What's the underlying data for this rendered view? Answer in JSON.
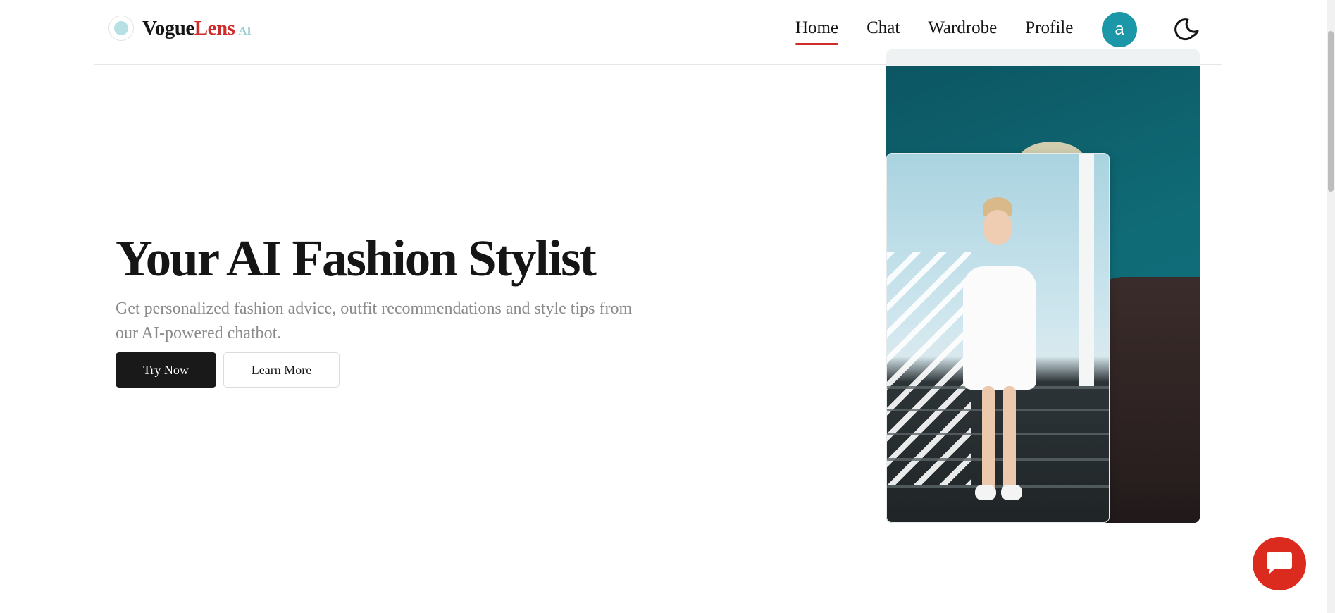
{
  "brand": {
    "name_part1": "Vogue",
    "name_part2": "Lens",
    "suffix": "AI"
  },
  "nav": {
    "items": [
      {
        "label": "Home",
        "active": true
      },
      {
        "label": "Chat",
        "active": false
      },
      {
        "label": "Wardrobe",
        "active": false
      },
      {
        "label": "Profile",
        "active": false
      }
    ],
    "avatar_initial": "a",
    "theme_toggle_icon": "moon-icon"
  },
  "hero": {
    "title": "Your AI Fashion Stylist",
    "subtitle": "Get personalized fashion advice, outfit recommendations and style tips from our AI-powered chatbot.",
    "primary_button": "Try Now",
    "secondary_button": "Learn More"
  },
  "images": {
    "back_photo": "model-in-dark-coat-on-teal-background",
    "front_photo": "woman-in-white-dress-on-stairs"
  },
  "chat_fab_icon": "chat-bubble-icon",
  "colors": {
    "accent_red": "#cf2b2b",
    "avatar_teal": "#1c97a8",
    "logo_dot": "#b6e0e2",
    "fab_red": "#db2a1e",
    "primary_button": "#191919"
  }
}
